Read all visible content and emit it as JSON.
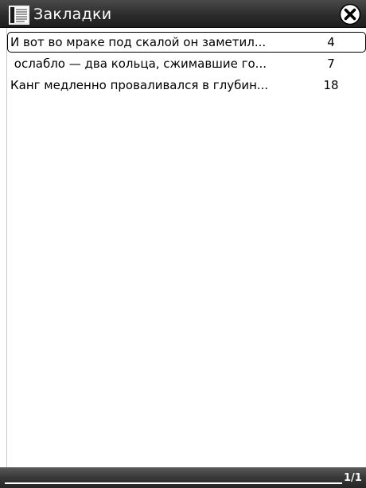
{
  "window": {
    "title": "Закладки",
    "icon": "bookmarks-book-icon",
    "close_icon": "close-x-icon"
  },
  "bookmarks": [
    {
      "text": "И вот во мраке под скалой он заметил...",
      "page": "4",
      "selected": true
    },
    {
      "text": " ослабло — два кольца, сжимавшие го...",
      "page": "7",
      "selected": false
    },
    {
      "text": "Канг медленно проваливался в глубин...",
      "page": "18",
      "selected": false
    }
  ],
  "status": {
    "page_indicator": "1/1"
  },
  "colors": {
    "titlebar": "#2c2c2c",
    "title_text": "#ffffff",
    "background": "#ffffff",
    "selection_border": "#000000"
  }
}
